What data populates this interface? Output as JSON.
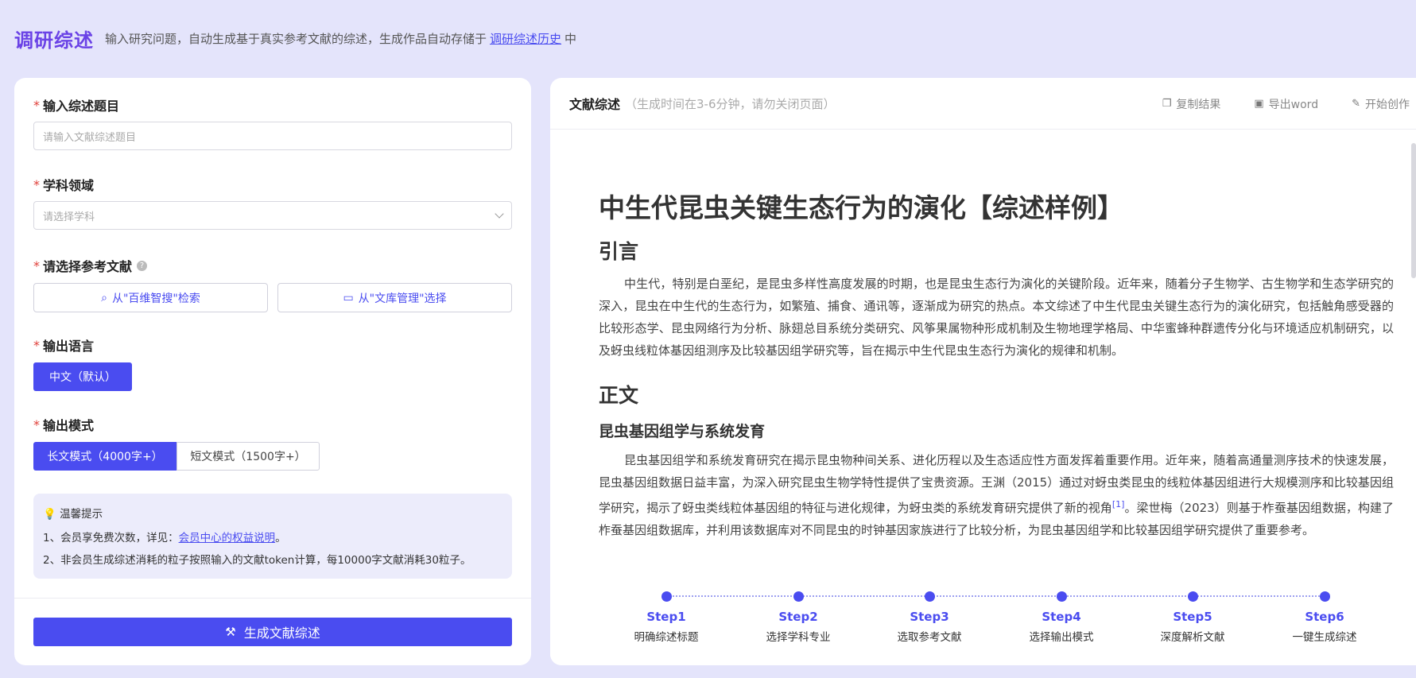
{
  "header": {
    "title": "调研综述",
    "desc_before": "输入研究问题，自动生成基于真实参考文献的综述，生成作品自动存储于",
    "history_link": "调研综述历史",
    "desc_after": "中"
  },
  "form": {
    "topic": {
      "label": "输入综述题目",
      "placeholder": "请输入文献综述题目"
    },
    "subject": {
      "label": "学科领域",
      "placeholder": "请选择学科"
    },
    "refs": {
      "label": "请选择参考文献",
      "help_icon": "question-icon",
      "search_btn": "从\"百维智搜\"检索",
      "library_btn": "从\"文库管理\"选择"
    },
    "language": {
      "label": "输出语言",
      "selected": "中文（默认）"
    },
    "mode": {
      "label": "输出模式",
      "long": "长文模式（4000字+）",
      "short": "短文模式（1500字+）"
    },
    "tips": {
      "title": "温馨提示",
      "line1_before": "1、会员享免费次数，详见：",
      "line1_link": "会员中心的权益说明",
      "line1_after": "。",
      "line2": "2、非会员生成综述消耗的粒子按照输入的文献token计算，每10000字文献消耗30粒子。"
    },
    "generate_btn": "生成文献综述"
  },
  "result": {
    "title": "文献综述",
    "subtitle": "（生成时间在3-6分钟，请勿关闭页面）",
    "actions": {
      "copy": "复制结果",
      "export": "导出word",
      "create": "开始创作"
    },
    "doc": {
      "title": "中生代昆虫关键生态行为的演化【综述样例】",
      "intro_heading": "引言",
      "intro_text": "中生代，特别是白垩纪，是昆虫多样性高度发展的时期，也是昆虫生态行为演化的关键阶段。近年来，随着分子生物学、古生物学和生态学研究的深入，昆虫在中生代的生态行为，如繁殖、捕食、通讯等，逐渐成为研究的热点。本文综述了中生代昆虫关键生态行为的演化研究，包括触角感受器的比较形态学、昆虫网络行为分析、脉翅总目系统分类研究、风筝果属物种形成机制及生物地理学格局、中华蜜蜂种群遗传分化与环境适应机制研究，以及蚜虫线粒体基因组测序及比较基因组学研究等，旨在揭示中生代昆虫生态行为演化的规律和机制。",
      "body_heading": "正文",
      "section1_heading": "昆虫基因组学与系统发育",
      "section1_text_before": "昆虫基因组学和系统发育研究在揭示昆虫物种间关系、进化历程以及生态适应性方面发挥着重要作用。近年来，随着高通量测序技术的快速发展，昆虫基因组数据日益丰富，为深入研究昆虫生物学特性提供了宝贵资源。王渊（2015）通过对蚜虫类昆虫的线粒体基因组进行大规模测序和比较基因组学研究，揭示了蚜虫类线粒体基因组的特征与进化规律，为蚜虫类的系统发育研究提供了新的视角",
      "section1_ref": "[1]",
      "section1_text_after": "。梁世梅（2023）则基于柞蚕基因组数据，构建了柞蚕基因组数据库，并利用该数据库对不同昆虫的时钟基因家族进行了比较分析，为昆虫基因组学和比较基因组学研究提供了重要参考。"
    }
  },
  "steps": [
    {
      "name": "Step1",
      "desc": "明确综述标题"
    },
    {
      "name": "Step2",
      "desc": "选择学科专业"
    },
    {
      "name": "Step3",
      "desc": "选取参考文献"
    },
    {
      "name": "Step4",
      "desc": "选择输出模式"
    },
    {
      "name": "Step5",
      "desc": "深度解析文献"
    },
    {
      "name": "Step6",
      "desc": "一键生成综述"
    }
  ]
}
